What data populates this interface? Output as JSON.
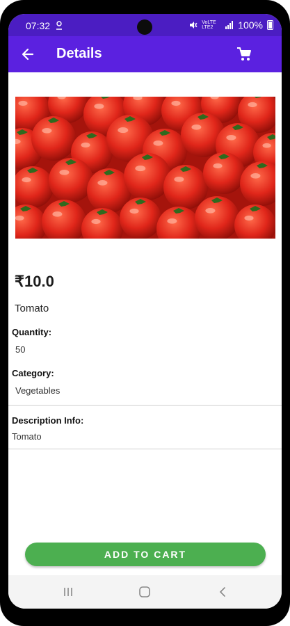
{
  "status_bar": {
    "time": "07:32",
    "network_label": "VoLTE LTE2",
    "battery_text": "100%",
    "icons": [
      "location-icon",
      "mute-icon",
      "signal-icon",
      "battery-icon"
    ]
  },
  "app_bar": {
    "title": "Details",
    "back_icon": "arrow-left-icon",
    "cart_icon": "cart-icon",
    "color": "#5b21e0"
  },
  "product": {
    "image": "tomatoes",
    "price": "₹10.0",
    "name": "Tomato",
    "quantity_label": "Quantity:",
    "quantity_value": "50",
    "category_label": "Category:",
    "category_value": "Vegetables",
    "description_label": "Description Info:",
    "description_value": "Tomato"
  },
  "actions": {
    "add_to_cart_label": "ADD TO CART",
    "button_color": "#4caf50"
  },
  "nav_bar": {
    "icons": [
      "recent-apps-icon",
      "home-icon",
      "back-nav-icon"
    ]
  }
}
